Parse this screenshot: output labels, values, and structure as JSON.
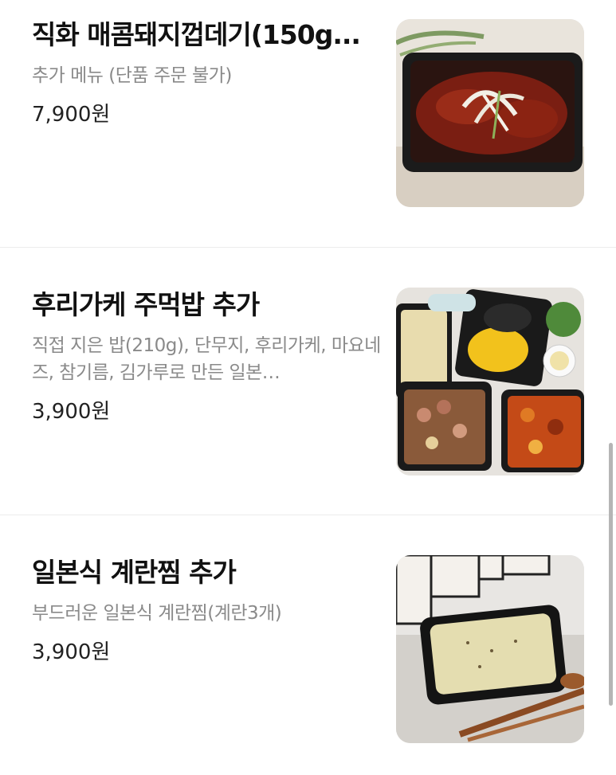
{
  "menu": {
    "items": [
      {
        "name": "직화 매콤돼지껍데기(150g...",
        "description": "추가 메뉴 (단품 주문 불가)",
        "price": "7,900원",
        "image": "spicy-pork-skin-photo"
      },
      {
        "name": "후리가케 주먹밥 추가",
        "description": "직접 지은 밥(210g), 단무지, 후리가케, 마요네즈, 참기름, 김가루로 만든 일본…",
        "price": "3,900원",
        "image": "furikake-rice-ball-photo"
      },
      {
        "name": "일본식 계란찜 추가",
        "description": "부드러운 일본식 계란찜(계란3개)",
        "price": "3,900원",
        "image": "japanese-steamed-egg-photo"
      }
    ]
  },
  "colors": {
    "title": "#111111",
    "description": "#8a8a8a",
    "price": "#222222",
    "divider": "#ececec",
    "scrollbar": "#b5b5b5"
  }
}
